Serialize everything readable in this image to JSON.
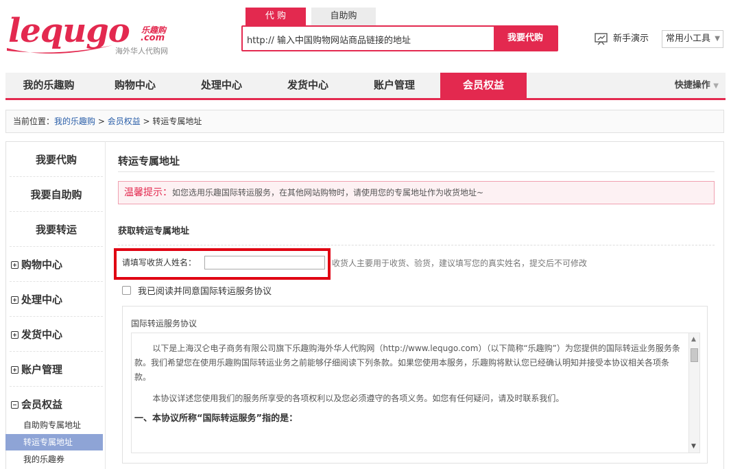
{
  "logo": {
    "main": "lequgo",
    "cn": "乐趣购",
    "com": ".com",
    "sub": "海外华人代购网"
  },
  "search": {
    "tabs": [
      {
        "label": "代 购"
      },
      {
        "label": "自助购"
      }
    ],
    "value": "http:// 输入中国购物网站商品链接的地址",
    "button": "我要代购"
  },
  "header": {
    "demo": "新手演示",
    "tools": "常用小工具"
  },
  "nav": {
    "items": [
      {
        "label": "我的乐趣购"
      },
      {
        "label": "购物中心"
      },
      {
        "label": "处理中心"
      },
      {
        "label": "发货中心"
      },
      {
        "label": "账户管理"
      },
      {
        "label": "会员权益"
      }
    ],
    "quick": "快捷操作"
  },
  "breadcrumb": {
    "prefix": "当前位置：",
    "home": "我的乐趣购",
    "sep1": " > ",
    "section": "会员权益",
    "sep2": " > ",
    "current": "转运专属地址"
  },
  "sidebar": {
    "top": [
      {
        "label": "我要代购"
      },
      {
        "label": "我要自助购"
      },
      {
        "label": "我要转运"
      }
    ],
    "groups": [
      {
        "label": "购物中心"
      },
      {
        "label": "处理中心"
      },
      {
        "label": "发货中心"
      },
      {
        "label": "账户管理"
      },
      {
        "label": "会员权益"
      }
    ],
    "subs": [
      {
        "label": "自助购专属地址"
      },
      {
        "label": "转运专属地址"
      },
      {
        "label": "我的乐趣券"
      }
    ]
  },
  "main": {
    "title": "转运专属地址",
    "tip_label": "温馨提示：",
    "tip_text": "如您选用乐趣国际转运服务，在其他网站购物时，请使用您的专属地址作为收货地址~",
    "sub_title": "获取转运专属地址",
    "name_label": "请填写收货人姓名：",
    "name_value": "",
    "name_hint": "收货人主要用于收货、验货，建议填写您的真实姓名，提交后不可修改",
    "agree_label": "我已阅读并同意国际转运服务协议",
    "agreement": {
      "title": "国际转运服务协议",
      "p1": "以下是上海汉仑电子商务有限公司旗下乐趣购海外华人代购网（http://www.lequgo.com）（以下简称“乐趣购”）为您提供的国际转运业务服务条款。我们希望您在使用乐趣购国际转运业务之前能够仔细阅读下列条款。如果您使用本服务，乐趣购将默认您已经确认明知并接受本协议相关各项条款。",
      "p2": "本协议详述您使用我们的服务所享受的各项权利以及您必须遵守的各项义务。如您有任何疑问，请及时联系我们。",
      "h1": "一、本协议所称“国际转运服务”指的是："
    }
  },
  "colors": {
    "accent": "#e3294f",
    "sidebar_active": "#8ea4d6",
    "link": "#2a5ea8",
    "highlight_box": "#e00012"
  }
}
